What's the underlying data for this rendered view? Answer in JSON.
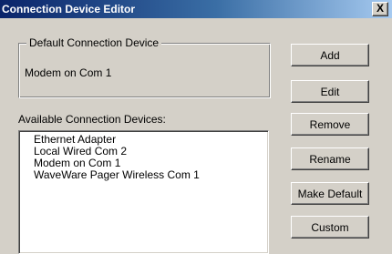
{
  "window": {
    "title": "Connection Device Editor",
    "close_glyph": "X"
  },
  "default_group": {
    "label": "Default Connection Device",
    "value": "Modem on Com 1"
  },
  "available": {
    "label": "Available Connection Devices:",
    "items": [
      "Ethernet Adapter",
      "Local Wired Com 2",
      "Modem on Com 1",
      "WaveWare Pager Wireless Com 1"
    ]
  },
  "buttons": {
    "add": "Add",
    "edit": "Edit",
    "remove": "Remove",
    "rename": "Rename",
    "make_default": "Make Default",
    "custom": "Custom"
  },
  "colors": {
    "face": "#d4d0c8",
    "title_start": "#0a246a",
    "title_end": "#a6caf0"
  }
}
